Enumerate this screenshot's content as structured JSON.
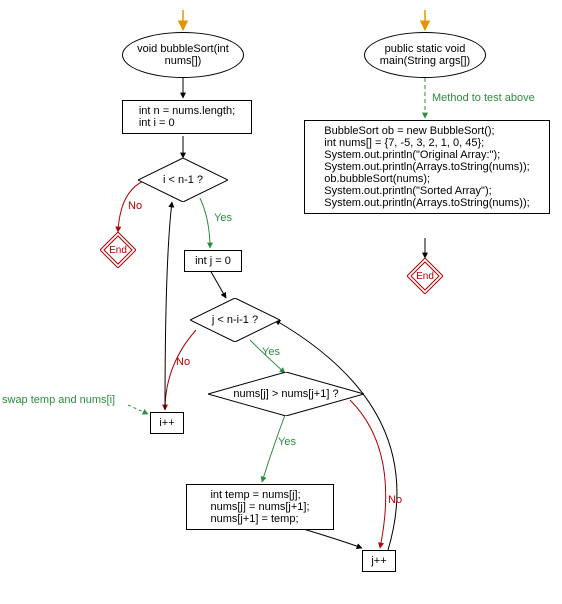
{
  "left": {
    "func_sig": "void bubbleSort(int\nnums[])",
    "init": "int n = nums.length;\nint i = 0",
    "cond_i": "i < n-1 ?",
    "init_j": "int j = 0",
    "cond_j": "j < n-i-1 ?",
    "cond_swap": "nums[j] > nums[j+1] ?",
    "swap_body": "int temp = nums[j];\nnums[j] = nums[j+1];\nnums[j+1] = temp;",
    "inc_i": "i++",
    "inc_j": "j++",
    "end": "End",
    "swap_note": "swap temp and nums[i]"
  },
  "right": {
    "func_sig": "public static void\nmain(String args[])",
    "method_note": "Method to test above",
    "body": "BubbleSort ob = new BubbleSort();\nint nums[] = {7, -5, 3, 2, 1, 0, 45};\nSystem.out.println(\"Original Array:\");\nSystem.out.println(Arrays.toString(nums));\nob.bubbleSort(nums);\nSystem.out.println(\"Sorted Array\");\nSystem.out.println(Arrays.toString(nums));",
    "end": "End"
  },
  "labels": {
    "yes": "Yes",
    "no": "No"
  }
}
